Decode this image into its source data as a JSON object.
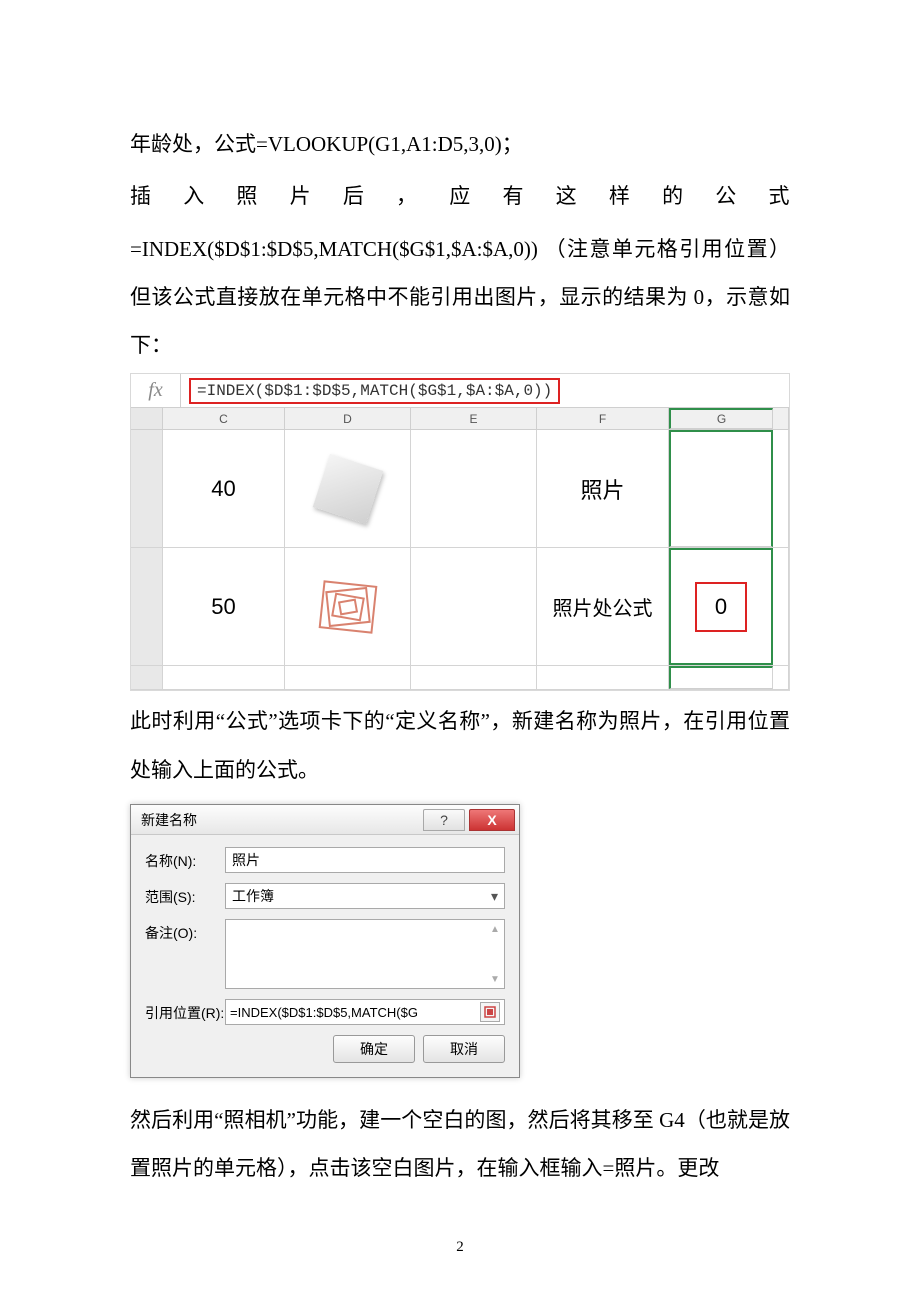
{
  "para1_prefix": "年龄处，公式",
  "para1_formula": "=VLOOKUP(G1,A1:D5,3,0)",
  "para1_suffix": "；",
  "para2_spread": "插入照片后，应有这样的公式",
  "para2b_formula": "=INDEX($D$1:$D$5,MATCH($G$1,$A:$A,0))",
  "para2b_note": "（注意单元格引用位置）但该公式直接放在单元格中不能引用出图片，显示的结果为 0，示意如下：",
  "excel1": {
    "fx_label": "fx",
    "formula": "=INDEX($D$1:$D$5,MATCH($G$1,$A:$A,0))",
    "cols": {
      "C": "C",
      "D": "D",
      "E": "E",
      "F": "F",
      "G": "G"
    },
    "row1": {
      "C": "40",
      "F": "照片"
    },
    "row2": {
      "C": "50",
      "F": "照片处公式",
      "G": "0"
    }
  },
  "para3": "此时利用“公式”选项卡下的“定义名称”，新建名称为照片，在引用位置处输入上面的公式。",
  "dialog": {
    "title": "新建名称",
    "help": "?",
    "close": "X",
    "name_label": "名称(N):",
    "name_value": "照片",
    "scope_label": "范围(S):",
    "scope_value": "工作簿",
    "comment_label": "备注(O):",
    "ref_label": "引用位置(R):",
    "ref_value": "=INDEX($D$1:$D$5,MATCH($G",
    "ok": "确定",
    "cancel": "取消"
  },
  "para4_a": "然后利用“照相机”功能，建一个空白的图，然后将其移至 ",
  "para4_g4": "G4",
  "para4_b": "（也就是放置照片的单元格），点击该空白图片，在输入框输入=照片。更改",
  "page_number": "2"
}
